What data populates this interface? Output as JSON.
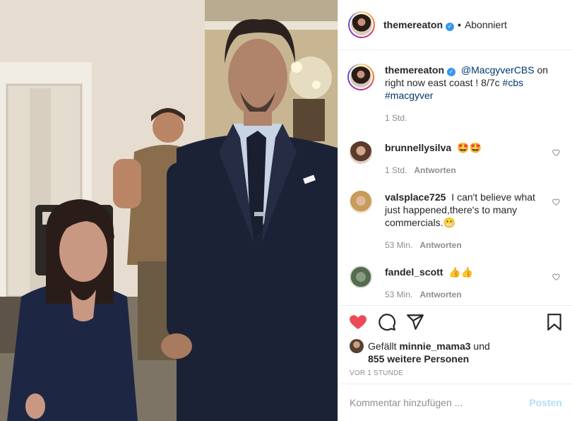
{
  "photo": {
    "alt_icon": "post-photo"
  },
  "header": {
    "username": "themereaton",
    "separator": "•",
    "follow_state": "Abonniert"
  },
  "caption": {
    "username": "themereaton",
    "mention": "@MacgyverCBS",
    "text": " on right now east coast ! 8/7c ",
    "tag1": "#cbs",
    "tag2": "#macgyver",
    "time": "1 Std."
  },
  "comments": [
    {
      "username": "brunnellysilva",
      "text": "🤩🤩",
      "time": "1 Std.",
      "reply": "Antworten"
    },
    {
      "username": "valsplace725",
      "text": "I can't believe what just happened,there's to many commercials.😬",
      "time": "53 Min.",
      "reply": "Antworten"
    },
    {
      "username": "fandel_scott",
      "text": "👍👍",
      "time": "53 Min.",
      "reply": "Antworten"
    }
  ],
  "likes": {
    "prefix": "Gefällt ",
    "user": "minnie_mama3",
    "mid": " und",
    "count": "855 weitere Personen"
  },
  "timestamp": "VOR 1 STUNDE",
  "composer": {
    "placeholder": "Kommentar hinzufügen ...",
    "post_label": "Posten"
  },
  "colors": {
    "like_red": "#ed4956",
    "link_blue": "#00376b",
    "post_disabled": "#b2dffc",
    "verified_blue": "#3897f0"
  }
}
